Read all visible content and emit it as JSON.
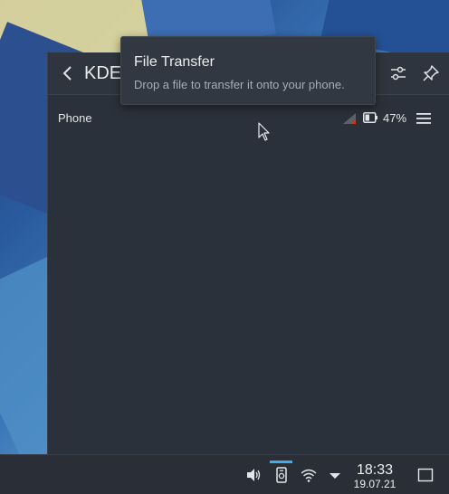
{
  "popup": {
    "title": "KDE",
    "device": {
      "name": "Phone",
      "battery_percent": "47%"
    }
  },
  "tooltip": {
    "title": "File Transfer",
    "subtitle": "Drop a file to transfer it onto your phone."
  },
  "panel": {
    "clock_time": "18:33",
    "clock_date": "19.07.21"
  },
  "colors": {
    "accent": "#3daee9",
    "popup_bg": "#2b313a",
    "panel_bg": "#2a2f37"
  },
  "icons": [
    "chevron-left-icon",
    "configure-icon",
    "pin-icon",
    "signal-icon",
    "battery-icon",
    "hamburger-menu-icon",
    "volume-icon",
    "kdeconnect-icon",
    "wifi-icon",
    "expand-arrow-icon",
    "show-desktop-icon",
    "mouse-cursor-icon"
  ]
}
